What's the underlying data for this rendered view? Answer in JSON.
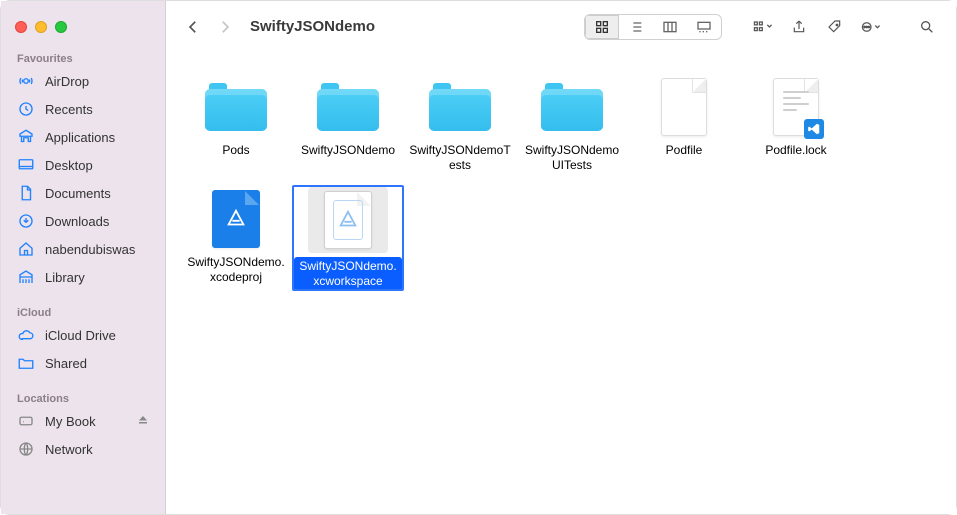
{
  "window": {
    "title": "SwiftyJSONdemo"
  },
  "sidebar": {
    "sections": [
      {
        "label": "Favourites",
        "items": [
          {
            "id": "airdrop",
            "label": "AirDrop"
          },
          {
            "id": "recents",
            "label": "Recents"
          },
          {
            "id": "applications",
            "label": "Applications"
          },
          {
            "id": "desktop",
            "label": "Desktop"
          },
          {
            "id": "documents",
            "label": "Documents"
          },
          {
            "id": "downloads",
            "label": "Downloads"
          },
          {
            "id": "home",
            "label": "nabendubiswas"
          },
          {
            "id": "library",
            "label": "Library"
          }
        ]
      },
      {
        "label": "iCloud",
        "items": [
          {
            "id": "iclouddrive",
            "label": "iCloud Drive"
          },
          {
            "id": "shared",
            "label": "Shared"
          }
        ]
      },
      {
        "label": "Locations",
        "items": [
          {
            "id": "mybook",
            "label": "My Book",
            "ejectable": true
          },
          {
            "id": "network",
            "label": "Network"
          }
        ]
      }
    ]
  },
  "files": [
    {
      "name": "Pods",
      "type": "folder"
    },
    {
      "name": "SwiftyJSONdemo",
      "type": "folder"
    },
    {
      "name": "SwiftyJSONdemoTests",
      "type": "folder"
    },
    {
      "name": "SwiftyJSONdemoUITests",
      "type": "folder"
    },
    {
      "name": "Podfile",
      "type": "file-plain"
    },
    {
      "name": "Podfile.lock",
      "type": "file-vscode"
    },
    {
      "name": "SwiftyJSONdemo.xcodeproj",
      "type": "xc-blue"
    },
    {
      "name": "SwiftyJSONdemo.xcworkspace",
      "type": "xc-white",
      "selected": true
    }
  ],
  "toolbar": {
    "view_mode": "icons"
  }
}
